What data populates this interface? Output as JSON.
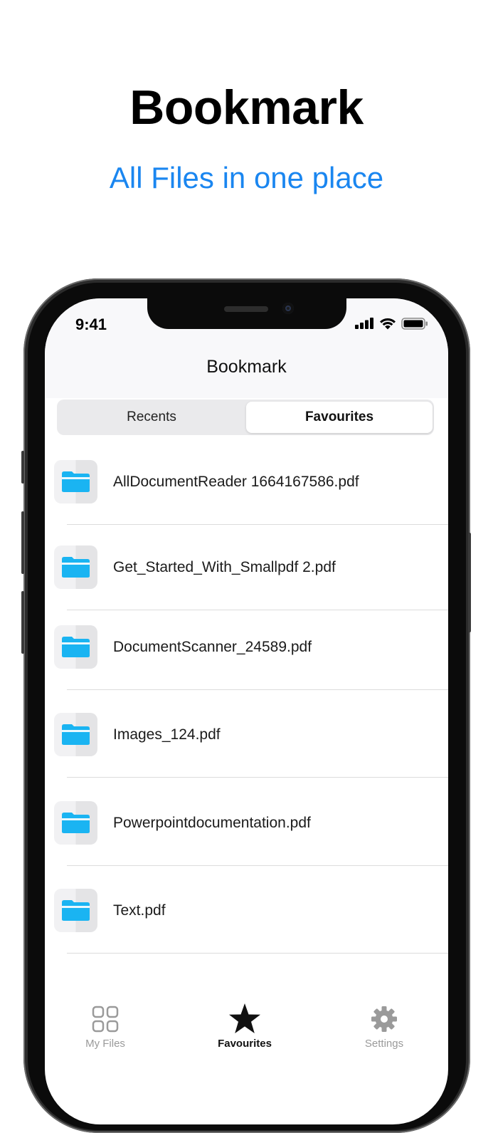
{
  "promo": {
    "title": "Bookmark",
    "subtitle": "All Files in one place"
  },
  "status_bar": {
    "time": "9:41",
    "icons": [
      "signal-icon",
      "wifi-icon",
      "battery-icon"
    ]
  },
  "nav": {
    "title": "Bookmark"
  },
  "segmented_control": {
    "options": [
      "Recents",
      "Favourites"
    ],
    "selected": "Favourites"
  },
  "files": [
    {
      "name": "AllDocumentReader 1664167586.pdf",
      "icon": "folder-icon"
    },
    {
      "name": "Get_Started_With_Smallpdf 2.pdf",
      "icon": "folder-icon"
    },
    {
      "name": "DocumentScanner_24589.pdf",
      "icon": "folder-icon"
    },
    {
      "name": "Images_124.pdf",
      "icon": "folder-icon"
    },
    {
      "name": "Powerpointdocumentation.pdf",
      "icon": "folder-icon"
    },
    {
      "name": "Text.pdf",
      "icon": "folder-icon"
    }
  ],
  "tab_bar": {
    "tabs": [
      {
        "label": "My Files",
        "icon": "grid-icon",
        "active": false
      },
      {
        "label": "Favourites",
        "icon": "star-icon",
        "active": true
      },
      {
        "label": "Settings",
        "icon": "gear-icon",
        "active": false
      }
    ]
  },
  "colors": {
    "accent": "#1a86f0",
    "folder": "#1ab4f2",
    "tab_inactive": "#9a9a9a",
    "tab_active": "#111111"
  }
}
